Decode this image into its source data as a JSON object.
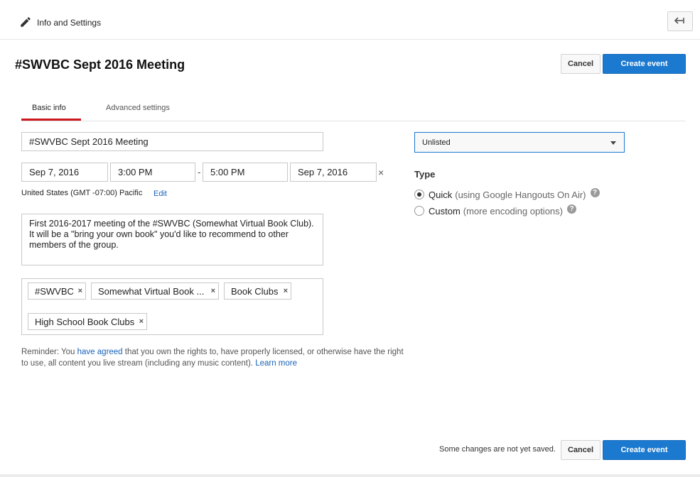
{
  "header": {
    "section_title": "Info and Settings",
    "icon": "pencil-icon",
    "back_icon": "back-arrow-icon"
  },
  "event": {
    "page_title": "#SWVBC Sept 2016 Meeting"
  },
  "actions": {
    "cancel_label": "Cancel",
    "create_label": "Create event"
  },
  "tabs": [
    {
      "label": "Basic info",
      "active": true
    },
    {
      "label": "Advanced settings",
      "active": false
    }
  ],
  "form": {
    "title_value": "#SWVBC Sept 2016 Meeting",
    "start_date": "Sep 7, 2016",
    "start_time": "3:00 PM",
    "separator": "-",
    "end_time": "5:00 PM",
    "end_date": "Sep 7, 2016",
    "clear_symbol": "×",
    "timezone": "United States (GMT -07:00) Pacific",
    "timezone_edit": "Edit",
    "description": "First 2016-2017 meeting of the #SWVBC (Somewhat Virtual Book Club). It will be a \"bring your own book\" you'd like to recommend to other members of the group.",
    "tags": [
      "#SWVBC",
      "Somewhat Virtual Book ...",
      "Book Clubs",
      "High School Book Clubs"
    ],
    "tag_remove_symbol": "×"
  },
  "reminder": {
    "prefix": "Reminder: You ",
    "link1": "have agreed",
    "middle": " that you own the rights to, have properly licensed, or otherwise have the right to use, all content you live stream (including any music content). ",
    "link2": "Learn more"
  },
  "privacy": {
    "selected": "Unlisted"
  },
  "type": {
    "title": "Type",
    "options": [
      {
        "label": "Quick",
        "desc": "(using Google Hangouts On Air)",
        "checked": true
      },
      {
        "label": "Custom",
        "desc": "(more encoding options)",
        "checked": false
      }
    ],
    "help_symbol": "?"
  },
  "footer": {
    "status": "Some changes are not yet saved."
  },
  "colors": {
    "accent_blue": "#1b79d0",
    "tab_red": "#cc181e",
    "link_blue": "#1a63b8"
  }
}
